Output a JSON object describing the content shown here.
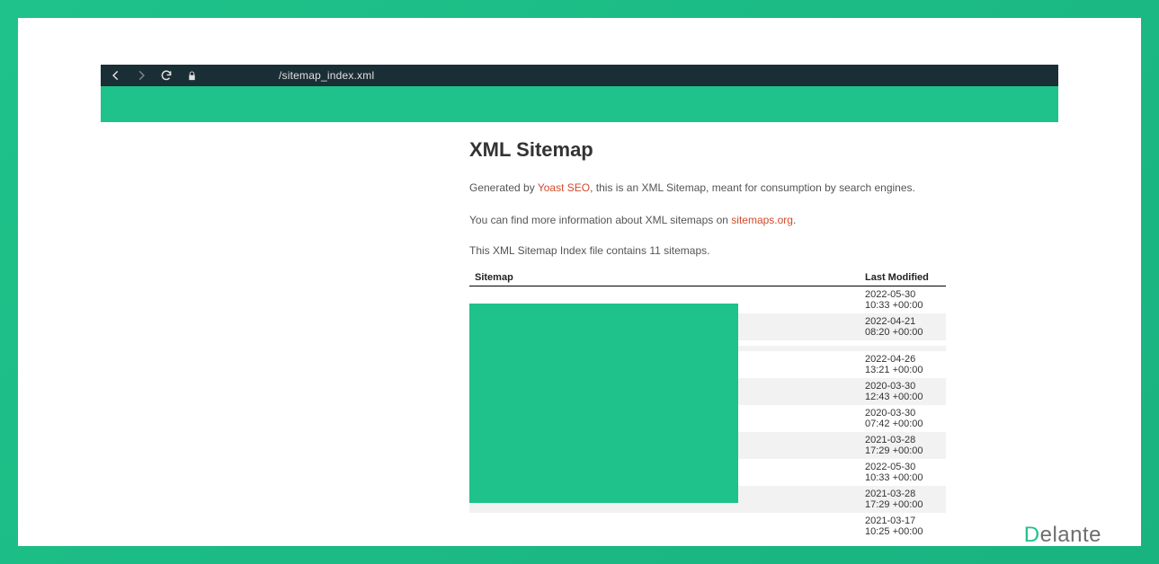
{
  "browser": {
    "url": "/sitemap_index.xml"
  },
  "page": {
    "title": "XML Sitemap",
    "generated_prefix": "Generated by ",
    "generated_link": "Yoast SEO",
    "generated_suffix": ", this is an XML Sitemap, meant for consumption by search engines.",
    "info_prefix": "You can find more information about XML sitemaps on ",
    "info_link": "sitemaps.org",
    "info_suffix": ".",
    "count_text": "This XML Sitemap Index file contains 11 sitemaps."
  },
  "table": {
    "col_sitemap": "Sitemap",
    "col_last_modified": "Last Modified",
    "rows": [
      {
        "sitemap": "",
        "last_modified": "2022-05-30 10:33 +00:00"
      },
      {
        "sitemap": "",
        "last_modified": "2022-04-21 08:20 +00:00"
      },
      {
        "sitemap": "",
        "last_modified": ""
      },
      {
        "sitemap": "",
        "last_modified": ""
      },
      {
        "sitemap": "",
        "last_modified": "2022-04-26 13:21 +00:00"
      },
      {
        "sitemap": "",
        "last_modified": "2020-03-30 12:43 +00:00"
      },
      {
        "sitemap": "",
        "last_modified": "2020-03-30 07:42 +00:00"
      },
      {
        "sitemap": "",
        "last_modified": "2021-03-28 17:29 +00:00"
      },
      {
        "sitemap": "",
        "last_modified": "2022-05-30 10:33 +00:00"
      },
      {
        "sitemap": "",
        "last_modified": "2021-03-28 17:29 +00:00"
      },
      {
        "sitemap": "",
        "last_modified": "2021-03-17 10:25 +00:00"
      }
    ]
  },
  "logo": {
    "first": "D",
    "rest": "elante"
  }
}
